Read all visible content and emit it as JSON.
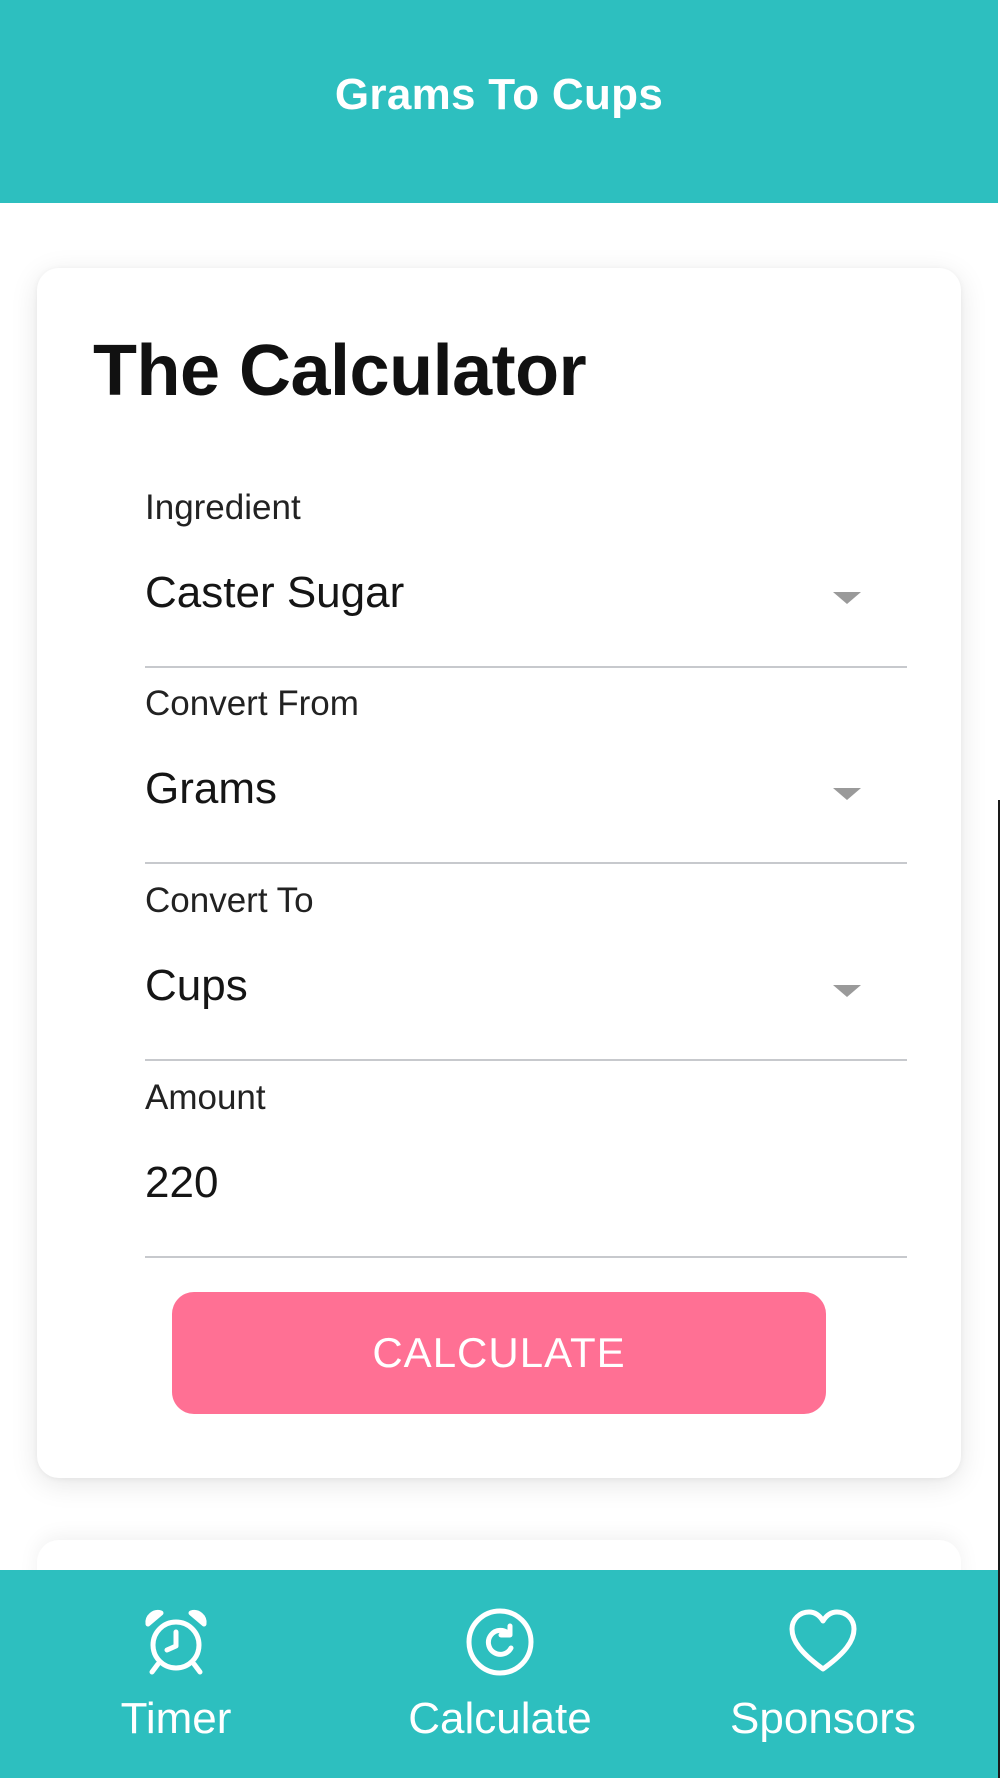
{
  "header": {
    "title": "Grams To Cups"
  },
  "calculator": {
    "title": "The Calculator",
    "fields": {
      "ingredient": {
        "label": "Ingredient",
        "value": "Caster Sugar"
      },
      "convert_from": {
        "label": "Convert From",
        "value": "Grams"
      },
      "convert_to": {
        "label": "Convert To",
        "value": "Cups"
      },
      "amount": {
        "label": "Amount",
        "value": "220"
      }
    },
    "button_label": "CALCULATE"
  },
  "bottom_nav": {
    "items": [
      {
        "label": "Timer",
        "icon": "alarm-clock-icon"
      },
      {
        "label": "Calculate",
        "icon": "refresh-icon"
      },
      {
        "label": "Sponsors",
        "icon": "heart-icon"
      }
    ]
  },
  "colors": {
    "primary": "#2dbfbf",
    "accent": "#ff7094",
    "text": "#111111",
    "underline": "#c7c9cd"
  }
}
